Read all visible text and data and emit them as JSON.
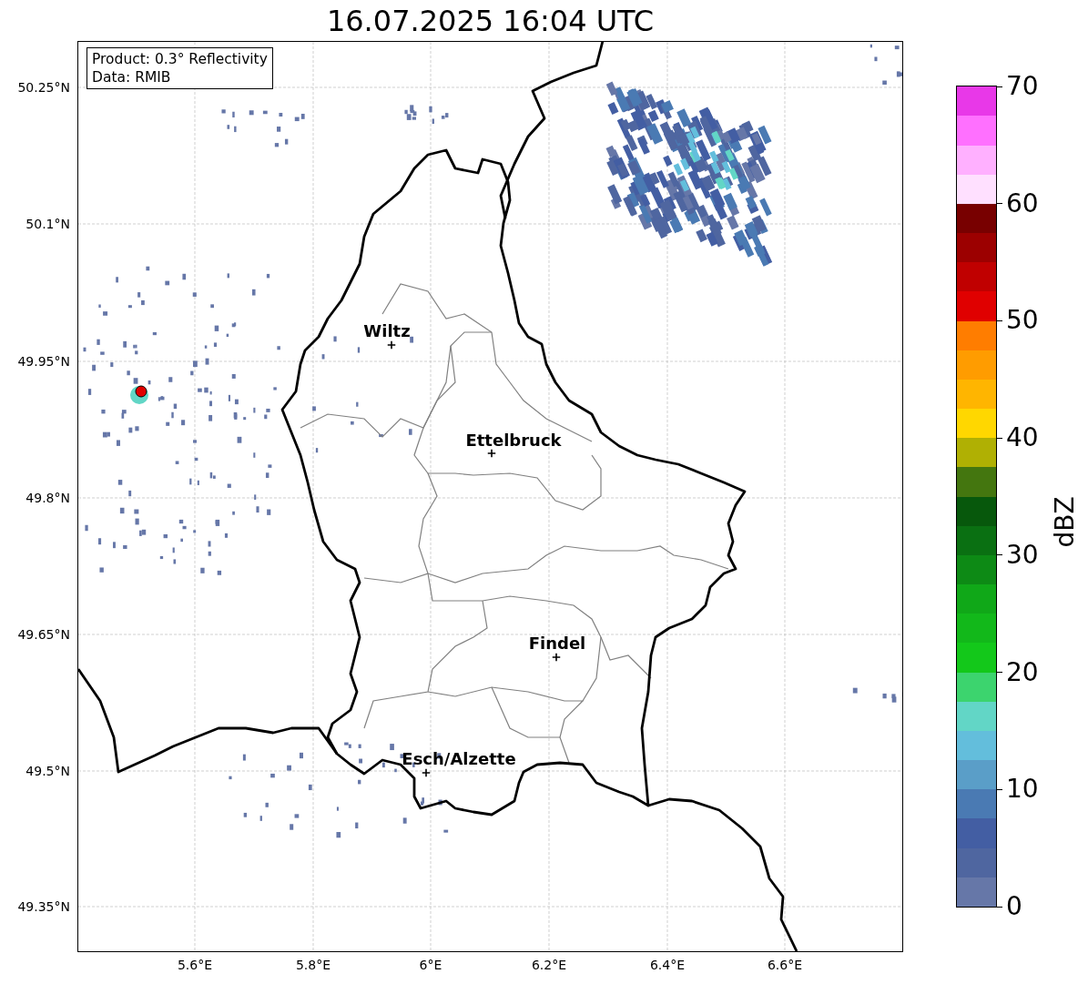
{
  "title": "16.07.2025 16:04 UTC",
  "info_box": [
    "Product: 0.3° Reflectivity",
    "Data: RMIB"
  ],
  "map": {
    "places": [
      {
        "name": "Wiltz"
      },
      {
        "name": "Ettelbruck"
      },
      {
        "name": "Findel"
      },
      {
        "name": "Esch/Alzette"
      }
    ]
  },
  "y_ticks": [
    "50.25°N",
    "50.1°N",
    "49.95°N",
    "49.8°N",
    "49.65°N",
    "49.5°N",
    "49.35°N"
  ],
  "x_ticks": [
    "5.6°E",
    "5.8°E",
    "6°E",
    "6.2°E",
    "6.4°E",
    "6.6°E"
  ],
  "colorbar": {
    "label": "dBZ",
    "ticks": [
      "70",
      "60",
      "50",
      "40",
      "30",
      "20",
      "10",
      "0"
    ],
    "bands": [
      {
        "color": "#6677a8"
      },
      {
        "color": "#4f66a0"
      },
      {
        "color": "#435ea3"
      },
      {
        "color": "#4a7ab3"
      },
      {
        "color": "#5a9ec8"
      },
      {
        "color": "#63bedc"
      },
      {
        "color": "#62d6c6"
      },
      {
        "color": "#3cd46e"
      },
      {
        "color": "#13c81a"
      },
      {
        "color": "#12b81a"
      },
      {
        "color": "#10a818"
      },
      {
        "color": "#0d8a15"
      },
      {
        "color": "#0a7012"
      },
      {
        "color": "#07580c"
      },
      {
        "color": "#44760f"
      },
      {
        "color": "#b0b003"
      },
      {
        "color": "#ffd700"
      },
      {
        "color": "#ffb500"
      },
      {
        "color": "#ff9c00"
      },
      {
        "color": "#ff7d00"
      },
      {
        "color": "#e00000"
      },
      {
        "color": "#c00000"
      },
      {
        "color": "#9c0000"
      },
      {
        "color": "#780000"
      },
      {
        "color": "#ffe0ff"
      },
      {
        "color": "#ffb0ff"
      },
      {
        "color": "#ff70ff"
      },
      {
        "color": "#e838e8"
      }
    ]
  }
}
